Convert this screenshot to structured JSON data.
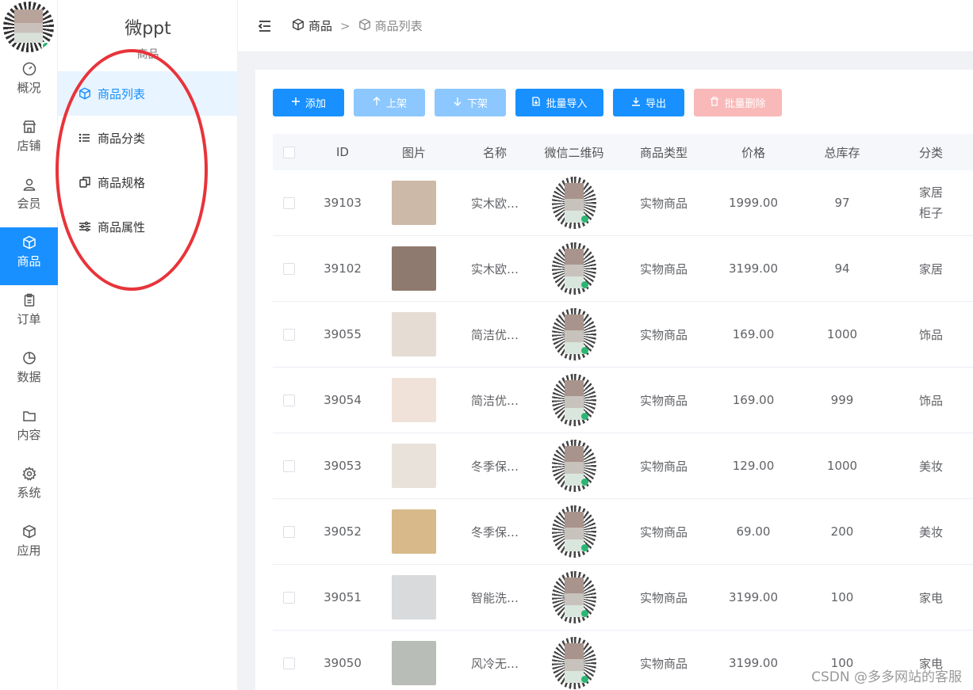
{
  "rail": {
    "items": [
      {
        "label": "概况",
        "icon": "dashboard-icon"
      },
      {
        "label": "店铺",
        "icon": "shop-icon"
      },
      {
        "label": "会员",
        "icon": "user-icon"
      },
      {
        "label": "商品",
        "icon": "box-icon",
        "active": true
      },
      {
        "label": "订单",
        "icon": "clipboard-icon"
      },
      {
        "label": "数据",
        "icon": "pie-chart-icon"
      },
      {
        "label": "内容",
        "icon": "folder-icon"
      },
      {
        "label": "系统",
        "icon": "gear-icon"
      },
      {
        "label": "应用",
        "icon": "box-icon"
      }
    ]
  },
  "submenu": {
    "brand": "微ppt",
    "section": "商品",
    "items": [
      {
        "label": "商品列表",
        "icon": "box-icon",
        "active": true
      },
      {
        "label": "商品分类",
        "icon": "list-icon"
      },
      {
        "label": "商品规格",
        "icon": "copy-icon"
      },
      {
        "label": "商品属性",
        "icon": "sliders-icon"
      }
    ]
  },
  "breadcrumb": {
    "first": "商品",
    "separator": ">",
    "second": "商品列表"
  },
  "toolbar": {
    "add": "添加",
    "up": "上架",
    "down": "下架",
    "import": "批量导入",
    "export": "导出",
    "delete": "批量删除"
  },
  "table": {
    "headers": {
      "id": "ID",
      "image": "图片",
      "name": "名称",
      "qr": "微信二维码",
      "type": "商品类型",
      "price": "价格",
      "stock": "总库存",
      "category": "分类"
    },
    "rows": [
      {
        "id": "39103",
        "name": "实木欧…",
        "type": "实物商品",
        "price": "1999.00",
        "stock": "97",
        "category": "家居",
        "category2": "柜子",
        "thumb": "#cdb9a8"
      },
      {
        "id": "39102",
        "name": "实木欧…",
        "type": "实物商品",
        "price": "3199.00",
        "stock": "94",
        "category": "家居",
        "category2": "",
        "thumb": "#8f7a6f"
      },
      {
        "id": "39055",
        "name": "简洁优…",
        "type": "实物商品",
        "price": "169.00",
        "stock": "1000",
        "category": "饰品",
        "category2": "",
        "thumb": "#e5ddd4"
      },
      {
        "id": "39054",
        "name": "简洁优…",
        "type": "实物商品",
        "price": "169.00",
        "stock": "999",
        "category": "饰品",
        "category2": "",
        "thumb": "#f1e2d9"
      },
      {
        "id": "39053",
        "name": "冬季保…",
        "type": "实物商品",
        "price": "129.00",
        "stock": "1000",
        "category": "美妆",
        "category2": "",
        "thumb": "#e9e2da"
      },
      {
        "id": "39052",
        "name": "冬季保…",
        "type": "实物商品",
        "price": "69.00",
        "stock": "200",
        "category": "美妆",
        "category2": "",
        "thumb": "#d8b98a"
      },
      {
        "id": "39051",
        "name": "智能洗…",
        "type": "实物商品",
        "price": "3199.00",
        "stock": "100",
        "category": "家电",
        "category2": "",
        "thumb": "#d9dadc"
      },
      {
        "id": "39050",
        "name": "风冷无…",
        "type": "实物商品",
        "price": "3199.00",
        "stock": "100",
        "category": "家电",
        "category2": "",
        "thumb": "#b9bdb7"
      }
    ]
  },
  "watermark": "CSDN @多多网站的客服"
}
